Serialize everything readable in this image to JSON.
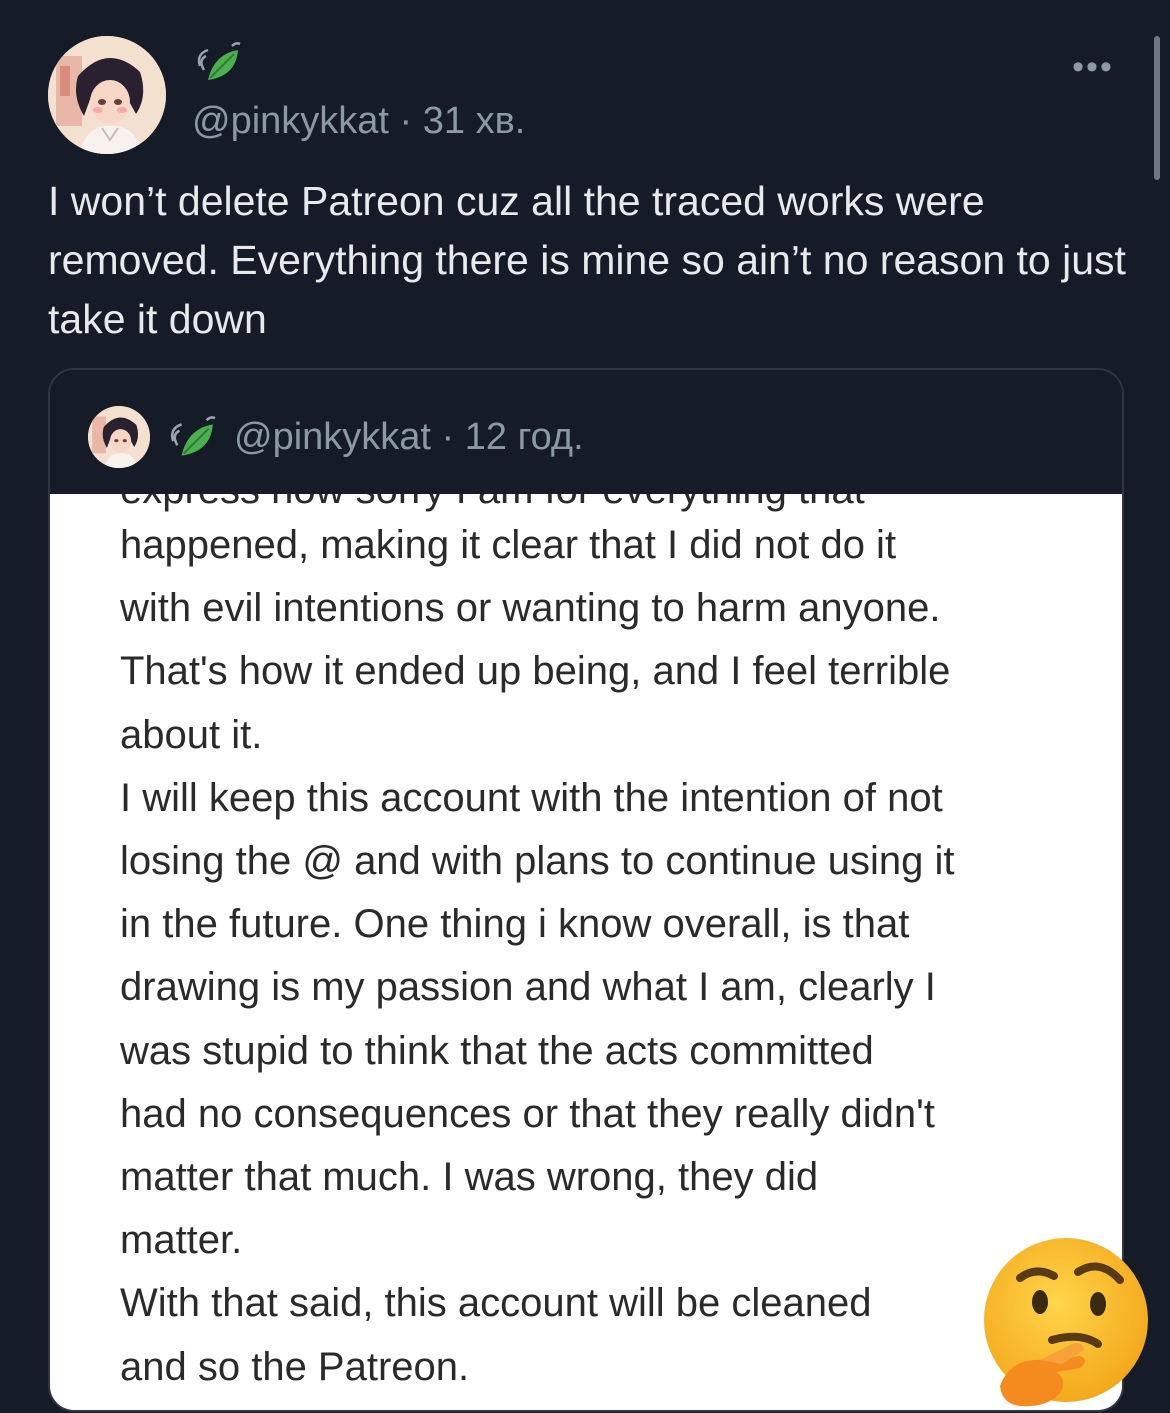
{
  "tweet": {
    "handle": "@pinkykkat",
    "separator": " · ",
    "time": "31 хв.",
    "more_label": "•••",
    "text": "I won’t delete Patreon cuz all the traced works were removed. Everything there is mine so ain’t no reason to just take it down"
  },
  "quote": {
    "handle": "@pinkykkat",
    "separator": " · ",
    "time": "12 год.",
    "image_text": {
      "partial_top_line": "express how sorry I am for everything that",
      "body": "happened, making it clear that I did not do it\nwith evil intentions or wanting to harm anyone.\nThat's how it ended up being, and I feel terrible\nabout it.\nI will keep this account with the intention of not\nlosing the @ and with plans to continue using it\nin the future. One thing i know overall, is that\ndrawing is my passion and what I am, clearly I\nwas stupid to think that the acts committed\nhad no consequences or that they really didn't\nmatter that much. I was wrong, they did\nmatter.\nWith that said, this account will be cleaned\nand so the Patreon."
    }
  },
  "icons": {
    "leaf_badge": "leaf-emoji-icon",
    "overlay_emoji": "thinking-face-emoji-icon"
  },
  "colors": {
    "background": "#151c28",
    "text_primary": "#e7e9ea",
    "text_secondary": "#8b98a5",
    "card_border": "#2f3640",
    "image_bg": "#ffffff",
    "image_text": "#2a2a2a"
  }
}
